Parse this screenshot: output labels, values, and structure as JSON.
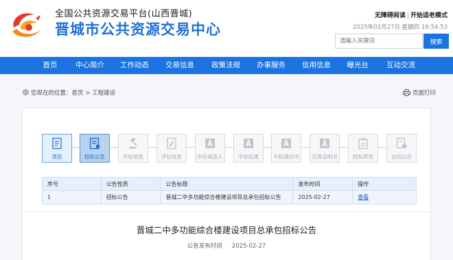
{
  "header": {
    "platform_subtitle": "全国公共资源交易平台(山西晋城)",
    "site_title": "晋城市公共资源交易中心",
    "accessible_link": "无障碍阅读",
    "elderly_link": "开始适老模式",
    "datetime": "2025年02月27日 星期四 16:54:53",
    "search_placeholder": "请输入关键词",
    "search_button": "搜索",
    "brand_color": "#1a73e0"
  },
  "nav": {
    "items": [
      "首页",
      "中心简介",
      "工作动态",
      "交易信息",
      "政策法规",
      "办事服务",
      "信用信息",
      "曝光台",
      "互动交流"
    ]
  },
  "breadcrumb": {
    "prefix": "您现在的位置：",
    "home": "首页",
    "separator": ">",
    "current": "工程建设",
    "print_label": "页面打印"
  },
  "steps": [
    {
      "label": "项目",
      "icon": "document-icon",
      "state": "active"
    },
    {
      "label": "招标公告",
      "icon": "announcement-icon",
      "state": "current"
    },
    {
      "label": "开标信息",
      "icon": "gavel-icon",
      "state": "disabled"
    },
    {
      "label": "评标信息",
      "icon": "edit-document-icon",
      "state": "disabled"
    },
    {
      "label": "中标候选人",
      "icon": "a-badge-icon",
      "state": "disabled"
    },
    {
      "label": "中标结果",
      "icon": "a-badge-icon",
      "state": "disabled"
    },
    {
      "label": "中标通知书",
      "icon": "a-badge-icon",
      "state": "disabled"
    },
    {
      "label": "交易证明书",
      "icon": "a-badge-icon",
      "state": "disabled"
    },
    {
      "label": "招标异常",
      "icon": "clipboard-icon",
      "state": "disabled"
    },
    {
      "label": "合同公示",
      "icon": "contract-icon",
      "state": "disabled"
    }
  ],
  "table": {
    "headers": [
      "序号",
      "公告性质",
      "公告标题",
      "发布时间",
      "操作"
    ],
    "rows": [
      [
        "1",
        "招标公告",
        "晋城二中多功能综合楼建设项目总承包招标公告",
        "2025-02-27",
        "查看"
      ]
    ]
  },
  "article": {
    "title": "晋城二中多功能综合楼建设项目总承包招标公告",
    "publish_label": "公告发布时间",
    "publish_date": "2025-02-27"
  }
}
